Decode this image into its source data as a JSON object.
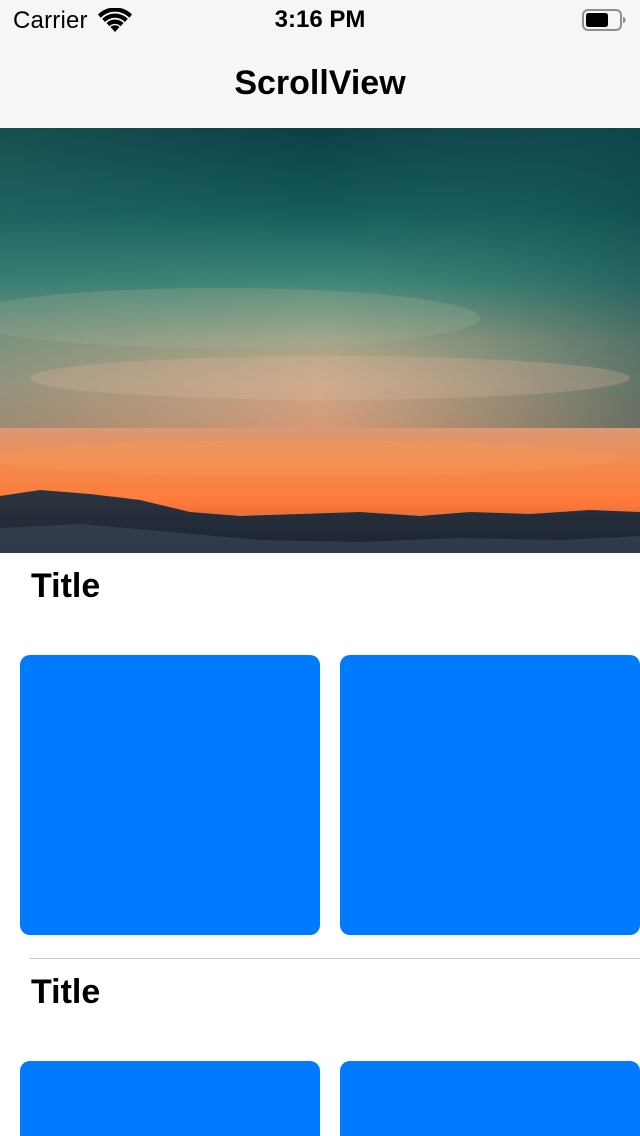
{
  "status_bar": {
    "carrier": "Carrier",
    "time": "3:16 PM",
    "wifi_icon": "wifi-icon",
    "battery_icon": "battery-icon"
  },
  "nav_bar": {
    "title": "ScrollView"
  },
  "hero": {
    "icon": "sunset-landscape-image"
  },
  "sections": [
    {
      "title": "Title",
      "cards": [
        "blue-card",
        "blue-card"
      ]
    },
    {
      "title": "Title",
      "cards": [
        "blue-card",
        "blue-card"
      ]
    }
  ],
  "colors": {
    "card": "#007aff",
    "bar_background": "#f7f6f7",
    "divider": "#c8c7cc"
  }
}
